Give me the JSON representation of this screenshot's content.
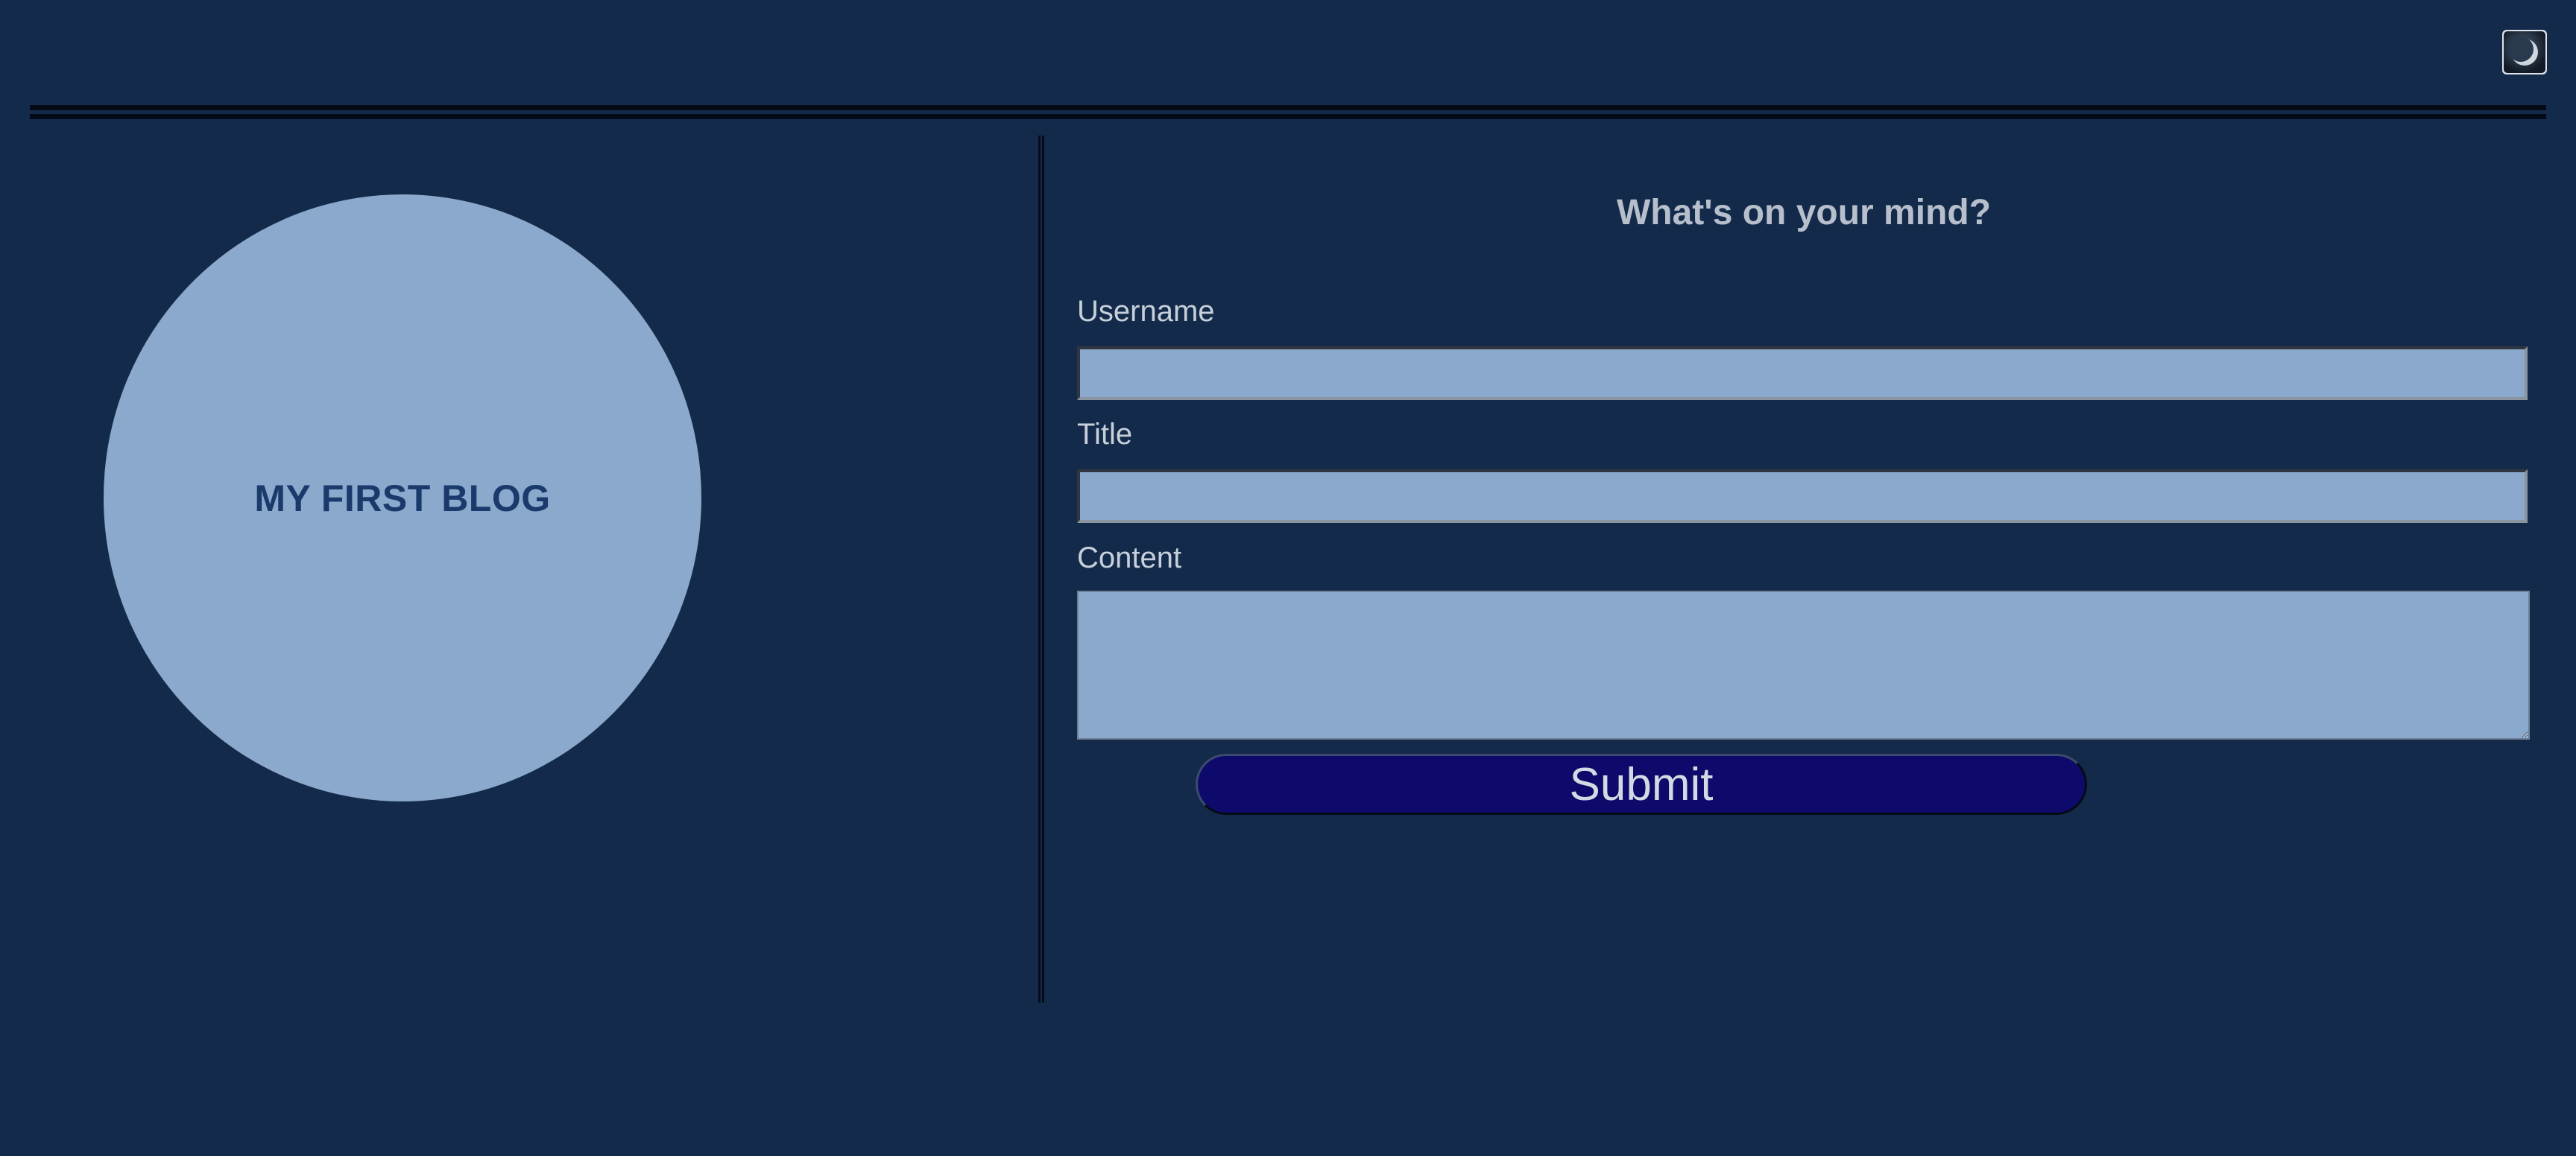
{
  "header": {
    "theme_toggle_icon": "moon-icon"
  },
  "logo": {
    "text": "MY FIRST BLOG"
  },
  "form": {
    "heading": "What's on your mind?",
    "username_label": "Username",
    "username_value": "",
    "title_label": "Title",
    "title_value": "",
    "content_label": "Content",
    "content_value": "",
    "submit_label": "Submit"
  },
  "colors": {
    "background": "#142a4b",
    "accent_light": "#8ba9cc",
    "button": "#0d0a6b"
  }
}
